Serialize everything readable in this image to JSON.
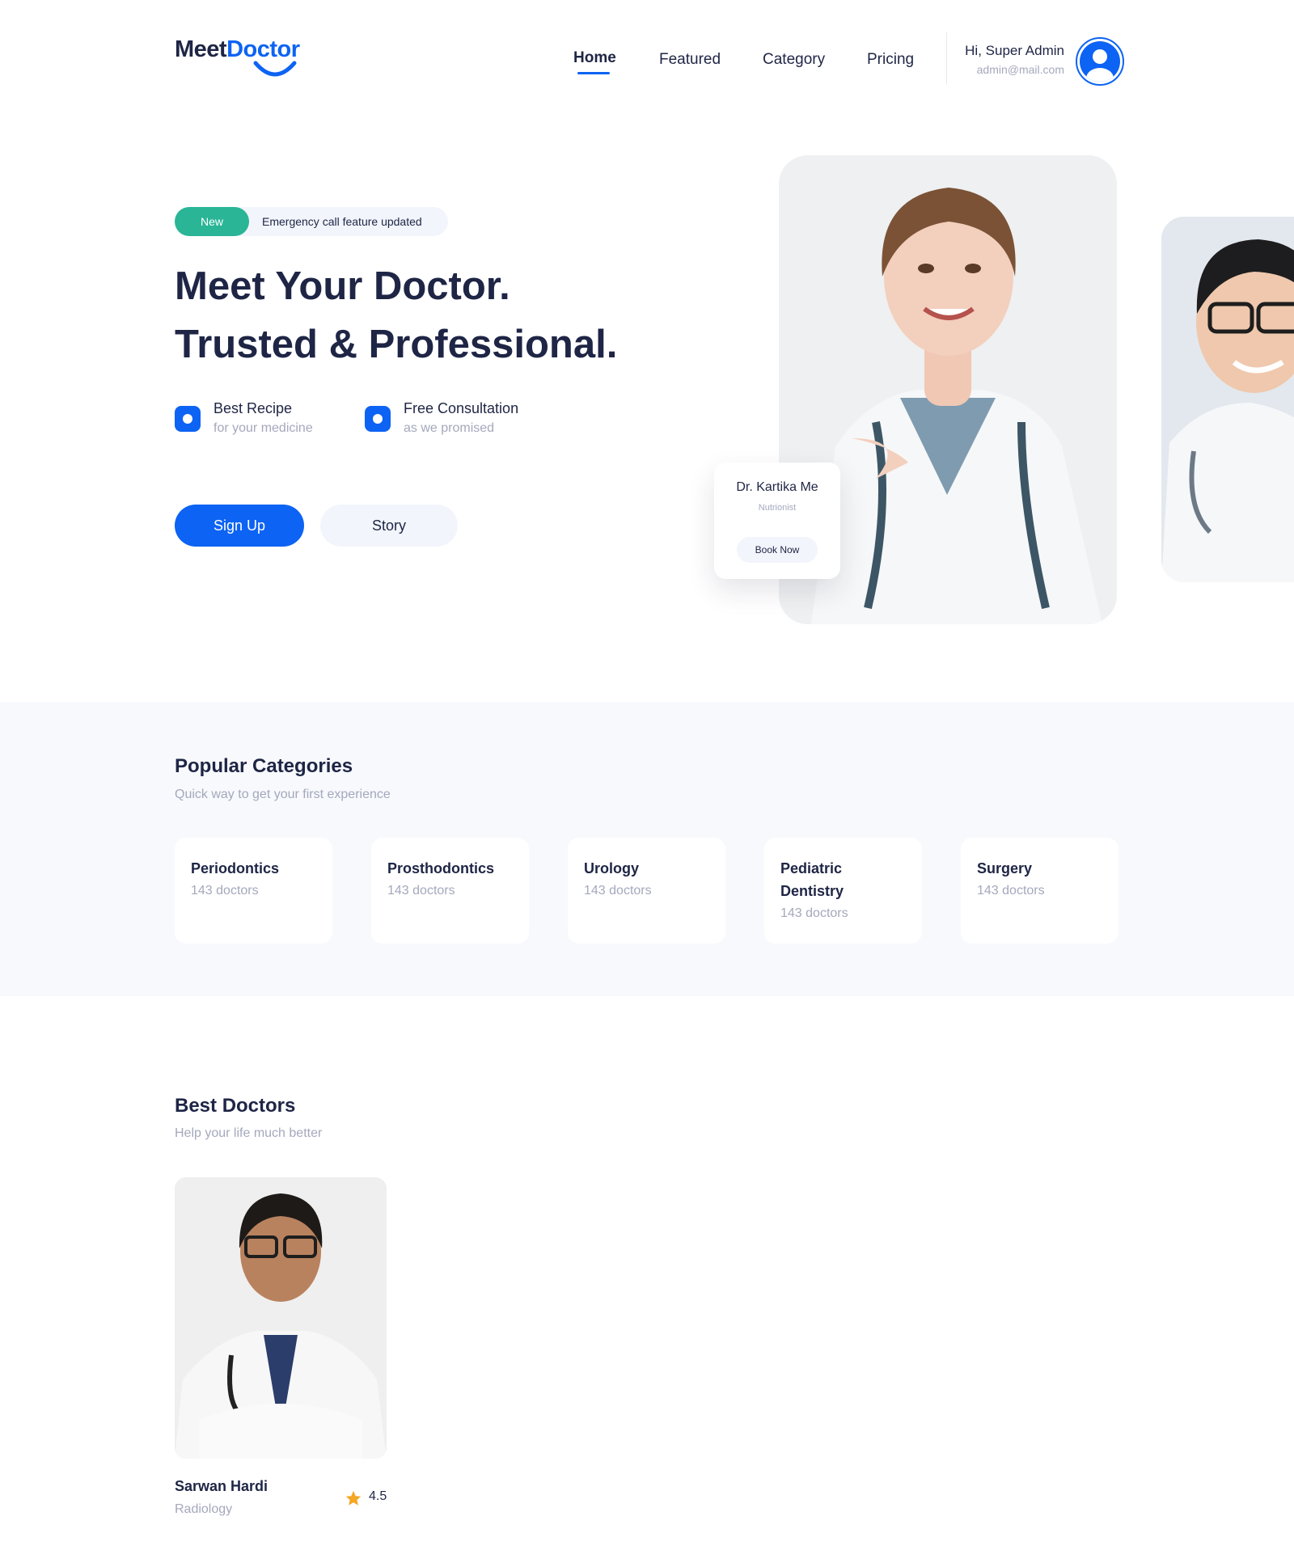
{
  "brand": {
    "name_part1": "Meet",
    "name_part2": "Doctor",
    "primary_color": "#0d63f3",
    "accent_color": "#2ab597"
  },
  "nav": {
    "items": [
      {
        "label": "Home",
        "active": true
      },
      {
        "label": "Featured",
        "active": false
      },
      {
        "label": "Category",
        "active": false
      },
      {
        "label": "Pricing",
        "active": false
      }
    ]
  },
  "user": {
    "greeting": "Hi, Super Admin",
    "email": "admin@mail.com",
    "avatar_icon": "user-avatar-icon"
  },
  "hero": {
    "badge_label": "New",
    "badge_text": "Emergency call feature updated",
    "title_line1": "Meet Your Doctor.",
    "title_line2": "Trusted & Professional.",
    "features": [
      {
        "title": "Best Recipe",
        "subtitle": "for your medicine"
      },
      {
        "title": "Free Consultation",
        "subtitle": "as we promised"
      }
    ],
    "primary_button": "Sign Up",
    "secondary_button": "Story",
    "doctor_card": {
      "name": "Dr. Kartika Me",
      "role": "Nutrionist",
      "button": "Book Now"
    }
  },
  "categories": {
    "title": "Popular Categories",
    "subtitle": "Quick way to get your first experience",
    "items": [
      {
        "name": "Periodontics",
        "count": "143 doctors"
      },
      {
        "name": "Prosthodontics",
        "count": "143 doctors"
      },
      {
        "name": "Urology",
        "count": "143 doctors"
      },
      {
        "name": "Pediatric Dentistry",
        "count": "143 doctors"
      },
      {
        "name": "Surgery",
        "count": "143 doctors"
      }
    ]
  },
  "best_doctors": {
    "title": "Best Doctors",
    "subtitle": "Help your life much better",
    "doctors": [
      {
        "name": "Sarwan Hardi",
        "specialty": "Radiology",
        "rating": "4.5",
        "rating_icon": "star-icon"
      }
    ]
  }
}
